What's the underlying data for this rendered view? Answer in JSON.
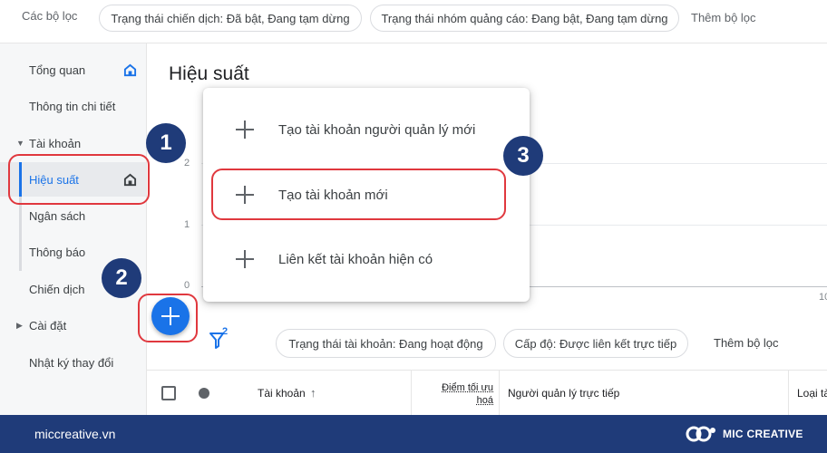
{
  "top_filters": {
    "label": "Các bộ lọc",
    "chips": [
      "Trạng thái chiến dịch: Đã bật, Đang tạm dừng",
      "Trạng thái nhóm quảng cáo: Đang bật, Đang tạm dừng"
    ],
    "add_filter": "Thêm bộ lọc"
  },
  "sidebar": {
    "items": [
      {
        "label": "Tổng quan"
      },
      {
        "label": "Thông tin chi tiết"
      },
      {
        "label": "Tài khoản"
      },
      {
        "label": "Hiệu suất"
      },
      {
        "label": "Ngân sách"
      },
      {
        "label": "Thông báo"
      },
      {
        "label": "Chiến dịch"
      },
      {
        "label": "Cài đặt"
      },
      {
        "label": "Nhật ký thay đổi"
      }
    ]
  },
  "main": {
    "title": "Hiệu suất",
    "y_ticks": [
      "2",
      "1",
      "0"
    ],
    "x_tick_partial": "10"
  },
  "menu": {
    "items": [
      "Tạo tài khoản người quản lý mới",
      "Tạo tài khoản mới",
      "Liên kết tài khoản hiện có"
    ]
  },
  "filters2": {
    "badge_count": "2",
    "chips": [
      "Trạng thái tài khoản: Đang hoạt động",
      "Cấp độ: Được liên kết trực tiếp"
    ],
    "add_filter": "Thêm bộ lọc"
  },
  "table": {
    "headers": [
      "Tài khoản",
      "Điểm tối ưu hoá",
      "Người quản lý trực tiếp",
      "Loại tà"
    ],
    "sort_arrow": "↑"
  },
  "annotations": [
    "1",
    "2",
    "3"
  ],
  "footer": {
    "site": "miccreative.vn",
    "brand": "MIC CREATIVE"
  },
  "colors": {
    "accent": "#1a73e8",
    "annotation_red": "#e0383e",
    "annotation_navy": "#1f3b79"
  }
}
